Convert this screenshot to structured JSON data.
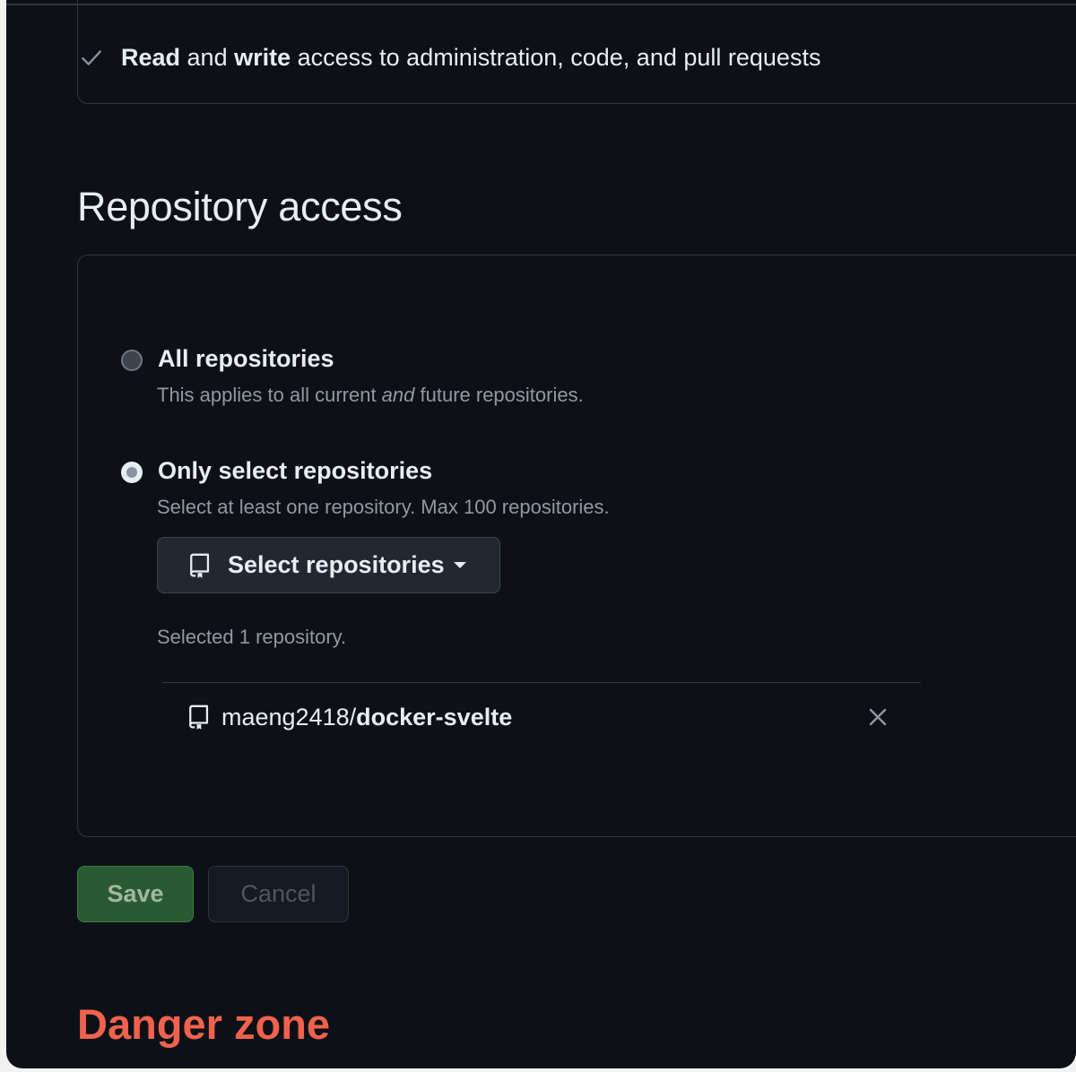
{
  "permissions": {
    "row": {
      "part1": "Read",
      "part2": " and ",
      "part3": "write",
      "part4": " access to administration, code, and pull requests"
    }
  },
  "repository_access": {
    "title": "Repository access",
    "all_option": {
      "label": "All repositories",
      "desc_before": "This applies to all current ",
      "desc_em": "and",
      "desc_after": " future repositories.",
      "selected": false
    },
    "select_option": {
      "label": "Only select repositories",
      "desc": "Select at least one repository. Max 100 repositories.",
      "selected": true
    },
    "select_button_label": "Select repositories",
    "selected_count_text": "Selected 1 repository.",
    "selected_repos": [
      {
        "owner": "maeng2418/",
        "name": "docker-svelte"
      }
    ]
  },
  "actions": {
    "save_label": "Save",
    "cancel_label": "Cancel"
  },
  "danger_zone": {
    "title": "Danger zone"
  },
  "icons": {
    "check": "check-icon",
    "repo": "repo-icon",
    "caret": "caret-down-icon",
    "remove": "x-icon"
  },
  "colors": {
    "background": "#0d1117",
    "border": "#30363d",
    "text": "#e6edf3",
    "muted": "#9198a1",
    "save_bg": "#2a5a31",
    "danger": "#f0624d"
  }
}
